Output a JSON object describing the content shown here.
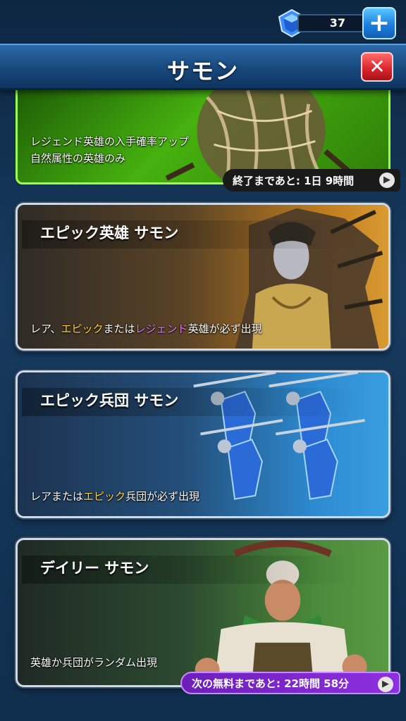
{
  "currency": {
    "gems": "37",
    "add_label": "+"
  },
  "header": {
    "title": "サモン",
    "close_label": "✕"
  },
  "legend_card": {
    "line1": "レジェンド英雄の入手確率アップ",
    "line2": "自然属性の英雄のみ",
    "timer": "終了まであと: 1日 9時間"
  },
  "cards": [
    {
      "title": "エピック英雄 サモン",
      "desc_parts": [
        "レア、",
        "エピック",
        "または",
        "レジェンド",
        "英雄が必ず出現"
      ]
    },
    {
      "title": "エピック兵団 サモン",
      "desc_parts": [
        "レアまたは",
        "エピック",
        "兵団が必ず出現"
      ]
    },
    {
      "title": "デイリー サモン",
      "desc": "英雄か兵団がランダム出現",
      "timer": "次の無料まであと: 22時間 58分"
    }
  ],
  "colors": {
    "epic_highlight": "#ffd24a",
    "legend_highlight": "#e07bff",
    "legend_border": "#9dff4a"
  }
}
